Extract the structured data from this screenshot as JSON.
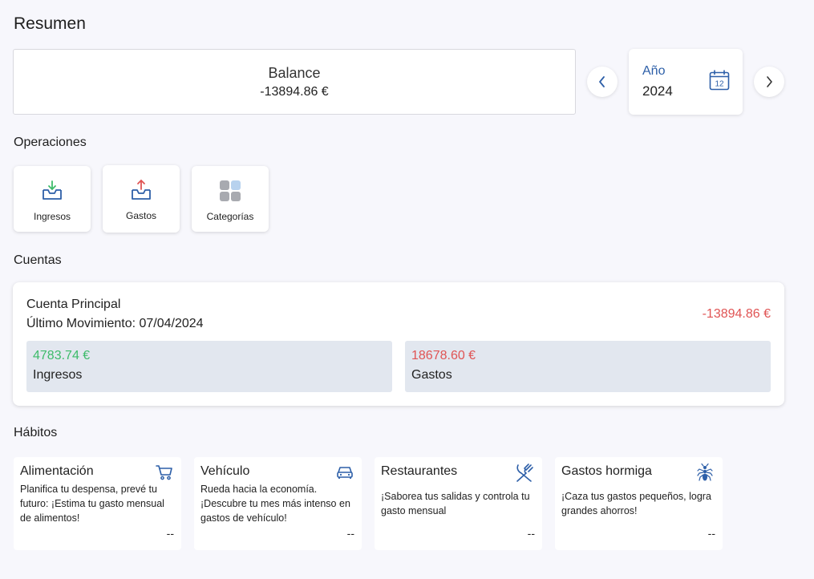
{
  "page": {
    "title": "Resumen"
  },
  "balance": {
    "title": "Balance",
    "value": "-13894.86 €"
  },
  "year_selector": {
    "label": "Año",
    "value": "2024",
    "calendar_day": "12"
  },
  "operations": {
    "title": "Operaciones",
    "items": [
      {
        "label": "Ingresos",
        "icon": "inbox-download-icon"
      },
      {
        "label": "Gastos",
        "icon": "inbox-upload-icon"
      },
      {
        "label": "Categorías",
        "icon": "grid-icon"
      }
    ]
  },
  "accounts": {
    "title": "Cuentas",
    "items": [
      {
        "name": "Cuenta Principal",
        "last_movement": "Último Movimiento: 07/04/2024",
        "total": "-13894.86 €",
        "income_amount": "4783.74 €",
        "income_label": "Ingresos",
        "expense_amount": "18678.60 €",
        "expense_label": "Gastos"
      }
    ]
  },
  "habits": {
    "title": "Hábitos",
    "items": [
      {
        "title": "Alimentación",
        "icon": "cart-icon",
        "description": "Planifica tu despensa, prevé tu futuro: ¡Estima tu gasto mensual de alimentos!",
        "value": "--"
      },
      {
        "title": "Vehículo",
        "icon": "car-icon",
        "description": "Rueda hacia la economía. ¡Descubre tu mes más intenso en gastos de vehículo!",
        "value": "--"
      },
      {
        "title": "Restaurantes",
        "icon": "utensils-icon",
        "description": "¡Saborea tus salidas y controla tu gasto mensual",
        "value": "--"
      },
      {
        "title": "Gastos hormiga",
        "icon": "ant-icon",
        "description": "¡Caza tus gastos pequeños, logra grandes ahorros!",
        "value": "--"
      }
    ]
  },
  "colors": {
    "accent": "#2d5fa8",
    "income": "#3dbb6a",
    "expense": "#e05454",
    "background": "#f7f7fc"
  }
}
